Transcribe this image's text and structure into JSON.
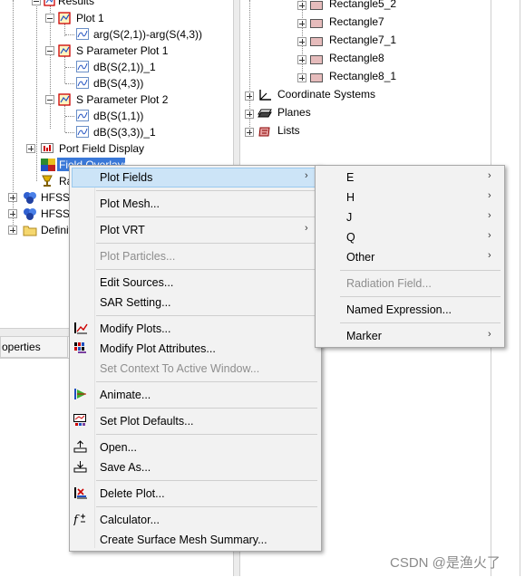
{
  "tree_left": {
    "results": "Results",
    "plot1": "Plot 1",
    "plot1_trace": "arg(S(2,1))-arg(S(4,3))",
    "sparam1": "S Parameter Plot 1",
    "sparam1_t1": "dB(S(2,1))_1",
    "sparam1_t2": "dB(S(4,3))",
    "sparam2": "S Parameter Plot 2",
    "sparam2_t1": "dB(S(1,1))",
    "sparam2_t2": "dB(S(3,3))_1",
    "port_field": "Port Field Display",
    "field_overlays": "Field Overlays",
    "radiation": "Ra",
    "hfss1": "HFSSD",
    "hfss2": "HFSSD",
    "definitions": "Definit"
  },
  "properties_label": "operties",
  "tree_right": {
    "items": [
      "Rectangle5_2",
      "Rectangle7",
      "Rectangle7_1",
      "Rectangle8",
      "Rectangle8_1"
    ],
    "coord": "Coordinate Systems",
    "planes": "Planes",
    "lists": "Lists"
  },
  "context_menu": {
    "plot_fields": "Plot Fields",
    "plot_mesh": "Plot Mesh...",
    "plot_vrt": "Plot VRT",
    "plot_particles": "Plot Particles...",
    "edit_sources": "Edit Sources...",
    "sar_setting": "SAR Setting...",
    "modify_plots": "Modify Plots...",
    "modify_attrs": "Modify Plot Attributes...",
    "set_context": "Set Context To Active Window...",
    "animate": "Animate...",
    "set_defaults": "Set Plot Defaults...",
    "open": "Open...",
    "save_as": "Save As...",
    "delete_plot": "Delete Plot...",
    "calculator": "Calculator...",
    "surface_mesh": "Create Surface Mesh Summary..."
  },
  "submenu": {
    "e": "E",
    "h": "H",
    "j": "J",
    "q": "Q",
    "other": "Other",
    "radiation_field": "Radiation Field...",
    "named_expression": "Named Expression...",
    "marker": "Marker"
  },
  "arrow_glyph": "›",
  "watermark": "CSDN @是渔火了",
  "colors": {
    "highlight": "#cce4f7",
    "menu_bg": "#f2f2f2",
    "disabled": "#8e8e8e"
  }
}
